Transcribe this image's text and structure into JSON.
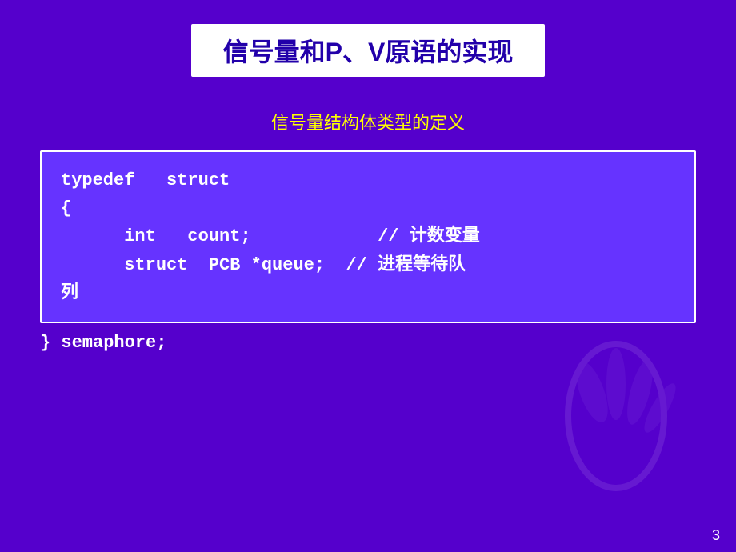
{
  "slide": {
    "background_color": "#5500cc",
    "title": {
      "text": "信号量和P、V原语的实现",
      "background": "white",
      "color": "#2200aa"
    },
    "subtitle": {
      "text": "信号量结构体类型的定义",
      "color": "#ffff00"
    },
    "code_block": {
      "line1": "typedef   struct",
      "line2": "{",
      "line3": "      int   count;",
      "line3_comment": "// 计数变量",
      "line4": "      struct  PCB *queue;",
      "line4_comment": "// 进程等待队",
      "line4_continuation": "列"
    },
    "footer_code": "} semaphore;",
    "page_number": "3"
  }
}
